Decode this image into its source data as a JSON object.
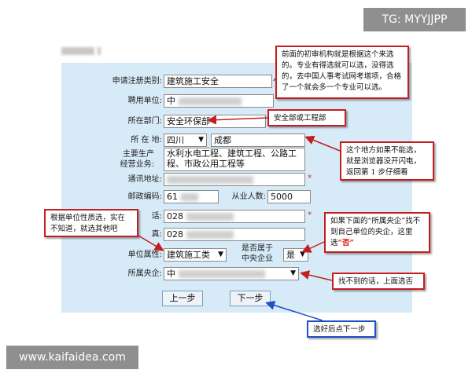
{
  "watermark": {
    "top": "TG: MYYJJPP",
    "bottom": "www.kaifaidea.com"
  },
  "colors": {
    "panel": "#d6eaf8",
    "note_red": "#c41f1f",
    "note_blue": "#1f4fc4"
  },
  "form": {
    "labels": {
      "reg_type": "申请注册类别:",
      "employer": "聘用单位:",
      "dept": "所在部门:",
      "location": "所 在 地:",
      "business": "主要生产\n经营业务:",
      "address": "通讯地址:",
      "postcode": "邮政编码:",
      "staff": "从业人数:",
      "phone_tail": "话:",
      "fax_tail": "真:",
      "unit_type": "单位属性:",
      "is_central": "是否属于\n中央企业",
      "central": "所属央企:"
    },
    "values": {
      "reg_type": "建筑施工安全",
      "employer": "中",
      "dept": "安全环保部",
      "province": "四川",
      "city": "成都",
      "business": "水利水电工程、建筑工程、公路工程、市政公用工程等",
      "address": "",
      "postcode": "61",
      "staff": "5000",
      "phone": "028",
      "fax": "028",
      "unit_type": "建筑施工类",
      "is_central": "是",
      "central": "中"
    },
    "required_mark": "*",
    "buttons": {
      "prev": "上一步",
      "next": "下一步"
    }
  },
  "notes": {
    "reg_type": "前面的初审机构就是根据这个来选的。专业有得选就可以选，没得选的，去中国人事考试网考增项，合格了一个就会多一个专业可以选。",
    "dept": "安全部或工程部",
    "location": "这个地方如果不能选，就是浏览器没开闪电，返回第 1 步仔细看",
    "unit_type": "根据单位性质选，实在不知道，就选其他吧",
    "central_pre": "如果下面的“所属央企”找不到自己单位的央企，这里选",
    "central_hl": "“否”",
    "central_missing": "找不到的话，上面选否",
    "next": "选好后点下一步"
  }
}
